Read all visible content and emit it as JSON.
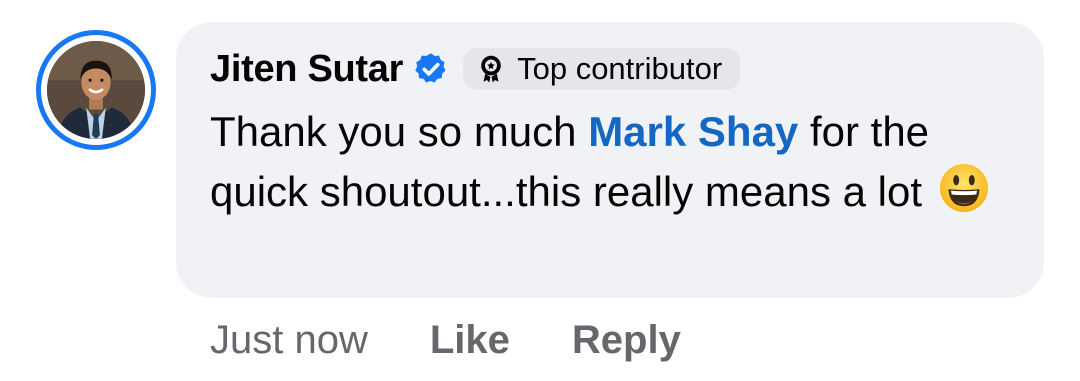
{
  "comment": {
    "author": "Jiten Sutar",
    "verified_icon": "verified-badge-icon",
    "badge": {
      "icon": "top-contributor-icon",
      "label": "Top contributor"
    },
    "message": {
      "before_mention": "Thank you so much ",
      "mention": "Mark Shay",
      "after_mention": " for the quick shoutout...this really means a lot",
      "emoji": "grinning-face-emoji"
    },
    "timestamp": "Just now",
    "like_label": "Like",
    "reply_label": "Reply"
  },
  "colors": {
    "bubble_bg": "#f0f2f5",
    "badge_bg": "#e4e6eb",
    "mention": "#1467c3",
    "verified": "#1877f2",
    "avatar_ring": "#1877f2",
    "meta_text": "#65676b"
  }
}
